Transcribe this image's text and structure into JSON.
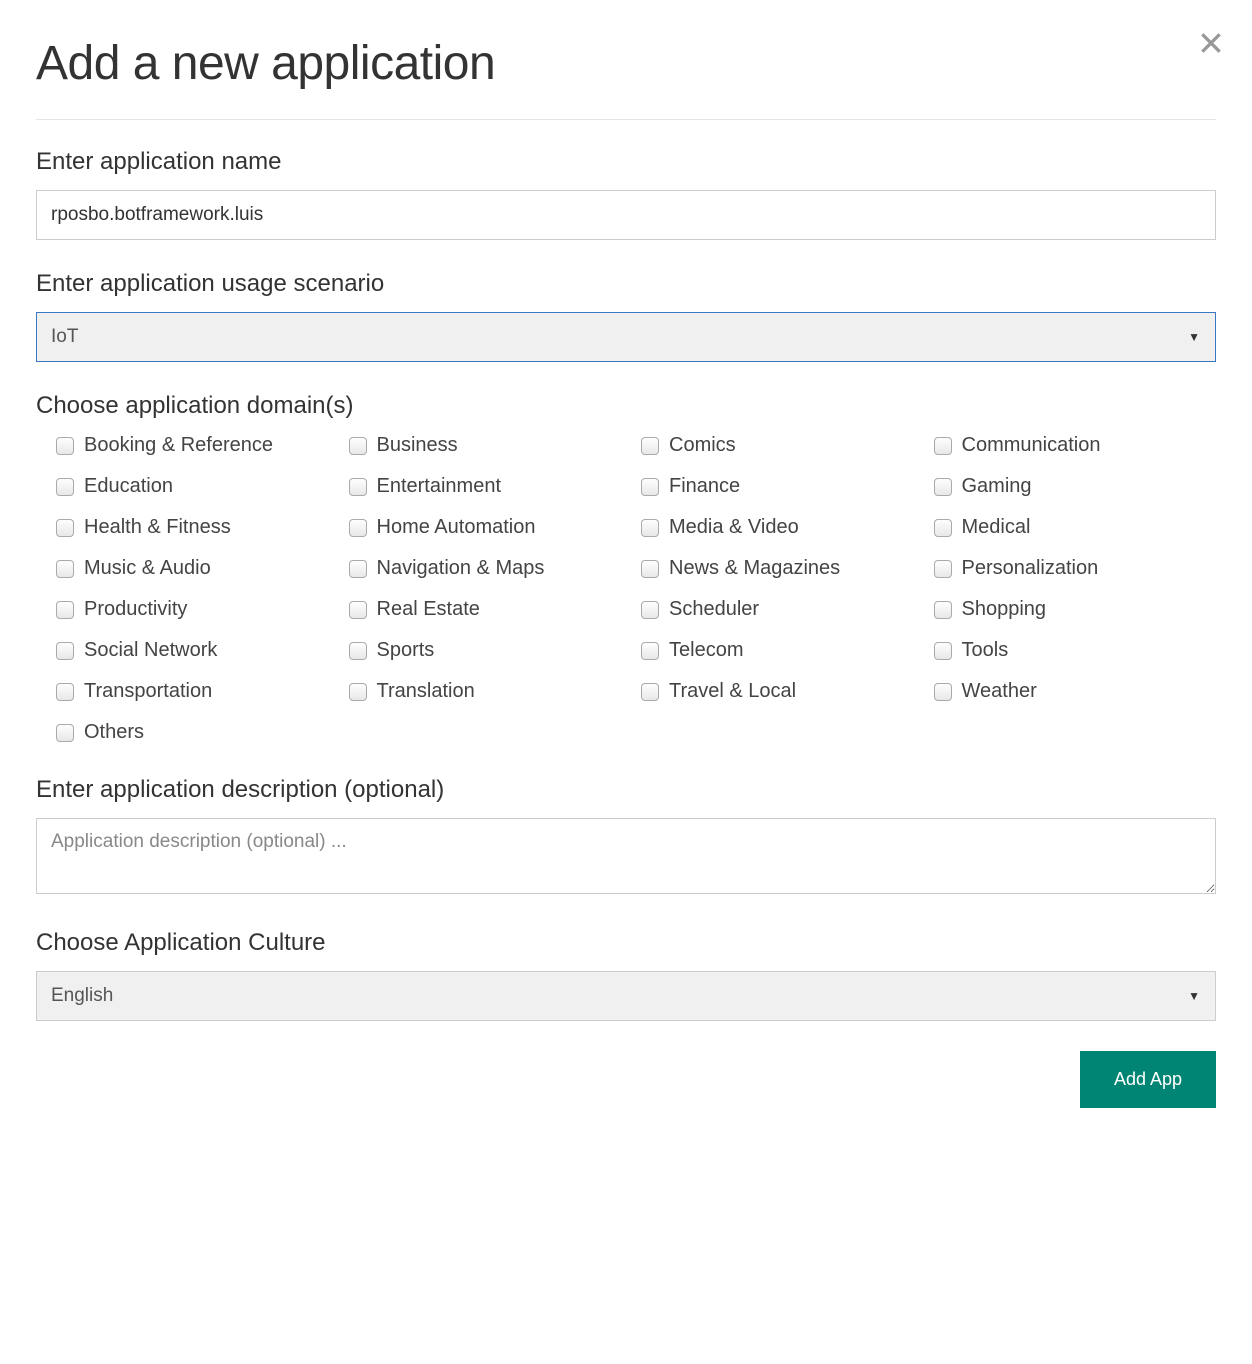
{
  "header": {
    "title": "Add a new application"
  },
  "appName": {
    "label": "Enter application name",
    "value": "rposbo.botframework.luis"
  },
  "scenario": {
    "label": "Enter application usage scenario",
    "selected": "IoT"
  },
  "domains": {
    "label": "Choose application domain(s)",
    "items": [
      "Booking & Reference",
      "Business",
      "Comics",
      "Communication",
      "Education",
      "Entertainment",
      "Finance",
      "Gaming",
      "Health & Fitness",
      "Home Automation",
      "Media & Video",
      "Medical",
      "Music & Audio",
      "Navigation & Maps",
      "News & Magazines",
      "Personalization",
      "Productivity",
      "Real Estate",
      "Scheduler",
      "Shopping",
      "Social Network",
      "Sports",
      "Telecom",
      "Tools",
      "Transportation",
      "Translation",
      "Travel & Local",
      "Weather",
      "Others"
    ]
  },
  "description": {
    "label": "Enter application description (optional)",
    "placeholder": "Application description (optional) ..."
  },
  "culture": {
    "label": "Choose Application Culture",
    "selected": "English"
  },
  "footer": {
    "addButton": "Add App"
  }
}
